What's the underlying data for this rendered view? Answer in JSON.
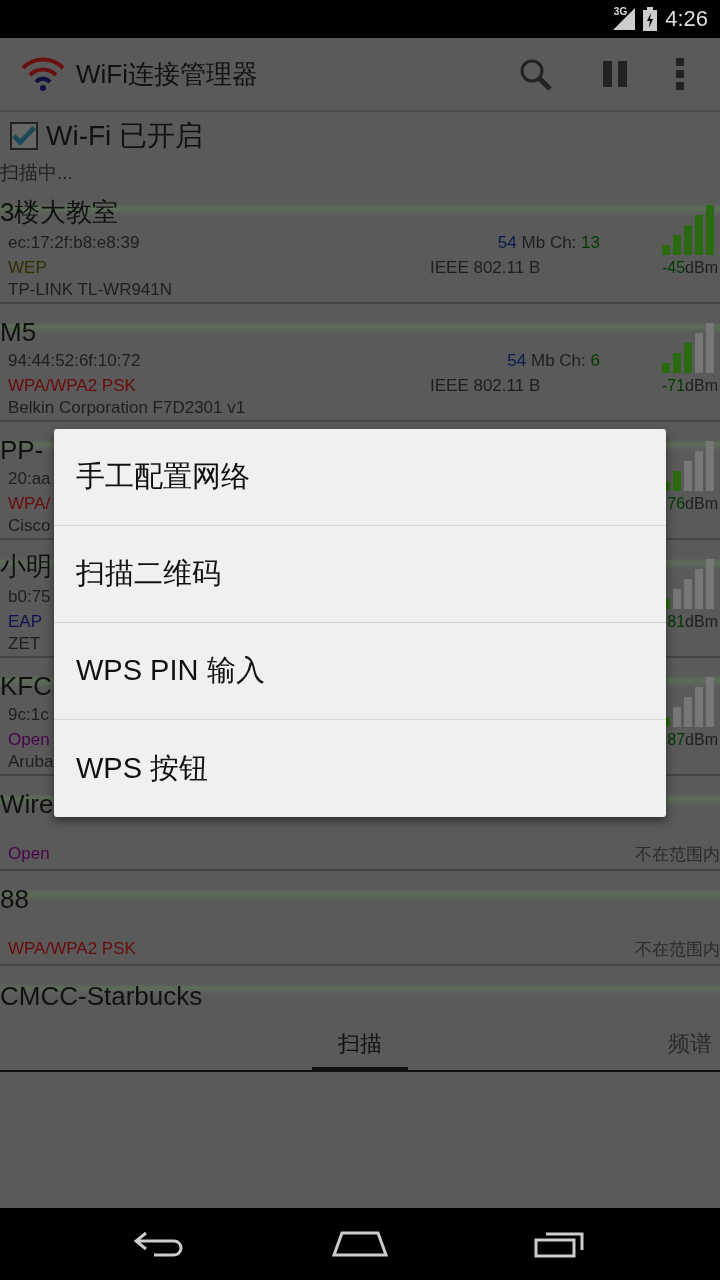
{
  "status_bar": {
    "network": "3G",
    "time": "4:26"
  },
  "action_bar": {
    "title": "WiFi连接管理器"
  },
  "wifi": {
    "label": "Wi-Fi 已开启",
    "checked": true
  },
  "scan_status": "扫描中...",
  "networks": [
    {
      "kind": "in_range",
      "name": "3楼大教室",
      "mac": "ec:17:2f:b8:e8:39",
      "rate": "54",
      "rate_unit": "Mb",
      "channel_label": "Ch:",
      "channel": "13",
      "security": "WEP",
      "color": "#303000",
      "standard": "IEEE 802.11 B",
      "dbm_sign": "-",
      "dbm": "45",
      "dbm_unit": "dBm",
      "vendor": "TP-LINK TL-WR941N"
    },
    {
      "kind": "in_range",
      "name": "M5",
      "mac": "94:44:52:6f:10:72",
      "rate": "54",
      "rate_unit": "Mb",
      "channel_label": "Ch:",
      "channel": "6",
      "security": "WPA/WPA2 PSK",
      "color": "#6a0a0a",
      "standard": "IEEE 802.11 B",
      "dbm_sign": "-",
      "dbm": "71",
      "dbm_unit": "dBm",
      "vendor": "Belkin Corporation F7D2301 v1"
    },
    {
      "kind": "in_range",
      "name": "PP-",
      "mac": "20:aa",
      "security": "WPA/",
      "color": "#6a0a0a",
      "dbm": "76",
      "dbm_unit": "dBm",
      "vendor": "Cisco"
    },
    {
      "kind": "in_range",
      "name": "小明",
      "mac": "b0:75",
      "security": "EAP",
      "color": "#101050",
      "dbm": "81",
      "dbm_unit": "dBm",
      "vendor": "ZET"
    },
    {
      "kind": "in_range",
      "name": "KFC",
      "mac": "9c:1c",
      "security": "Open",
      "color": "#4a004a",
      "dbm": "87",
      "dbm_unit": "dBm",
      "vendor": "Aruba"
    },
    {
      "kind": "out_of_range",
      "name": "Wire",
      "security": "Open",
      "color": "#4a004a",
      "range": "不在范围内"
    },
    {
      "kind": "out_of_range",
      "name": "88",
      "security": "WPA/WPA2 PSK",
      "color": "#6a0a0a",
      "range": "不在范围内"
    },
    {
      "kind": "name_only",
      "name": "CMCC-Starbucks"
    }
  ],
  "tabs": [
    {
      "label": "扫描",
      "selected": true
    },
    {
      "label": "频谱",
      "selected": false
    }
  ],
  "dialog": {
    "items": [
      "手工配置网络",
      "扫描二维码",
      "WPS PIN 输入",
      "WPS 按钮"
    ]
  }
}
